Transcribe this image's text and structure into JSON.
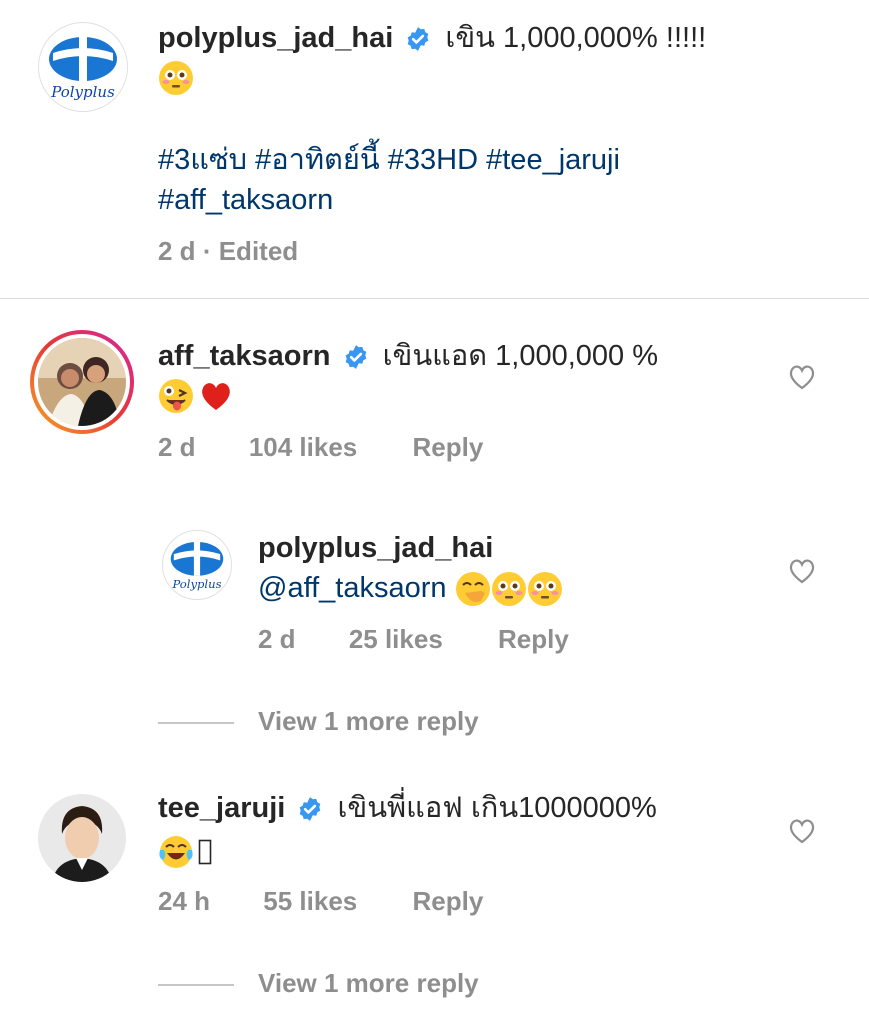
{
  "post": {
    "username": "polyplus_jad_hai",
    "caption_text": "เขิน 1,000,000% !!!!!",
    "hashtags": [
      "#3แซ่บ",
      "#อาทิตย์นี้",
      "#33HD",
      "#tee_jaruji",
      "#aff_taksaorn"
    ],
    "time": "2 d",
    "edited": "Edited",
    "avatar_logo_text": "Polyplus"
  },
  "comments": [
    {
      "username": "aff_taksaorn",
      "text": "เขินแอด 1,000,000 %",
      "emojis": [
        "zany-face",
        "red-heart"
      ],
      "time": "2 d",
      "likes": "104 likes",
      "reply_label": "Reply"
    },
    {
      "username": "polyplus_jad_hai",
      "mention": "@aff_taksaorn",
      "emojis": [
        "hand-over-mouth-face",
        "flushed-face",
        "flushed-face"
      ],
      "time": "2 d",
      "likes": "25 likes",
      "reply_label": "Reply",
      "avatar_logo_text": "Polyplus"
    },
    {
      "username": "tee_jaruji",
      "text": "เขินพี่แอฟ เกิน1000000%",
      "emojis": [
        "tears-of-joy-face",
        "missing-glyph"
      ],
      "time": "24 h",
      "likes": "55 likes",
      "reply_label": "Reply"
    }
  ],
  "view_more_1": "View 1 more reply",
  "view_more_2": "View 1 more reply",
  "colors": {
    "text": "#262626",
    "secondary": "#8e8e8e",
    "link": "#00376b",
    "verified": "#3897f0",
    "story_ring_start": "#f9a825",
    "story_ring_end": "#d6249f",
    "brand_blue": "#1565c0"
  }
}
